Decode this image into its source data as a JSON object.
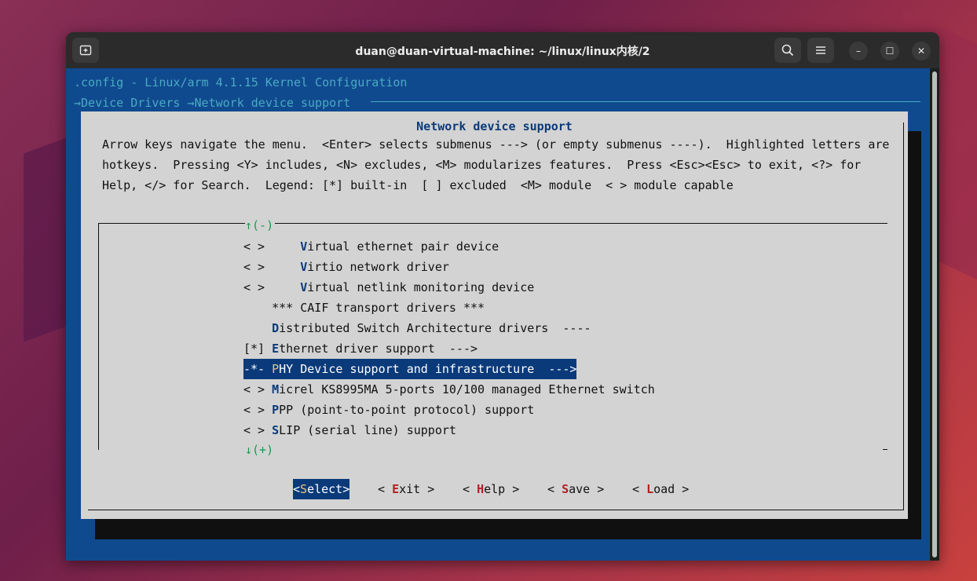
{
  "window": {
    "title": "duan@duan-virtual-machine: ~/linux/linux内核/2",
    "new_tab_icon": "new-tab-icon",
    "search_icon": "search-icon",
    "menu_icon": "hamburger-menu-icon",
    "minimize": "–",
    "maximize": "☐",
    "close": "✕"
  },
  "terminal": {
    "header": ".config - Linux/arm 4.1.15 Kernel Configuration",
    "breadcrumb": "→Device Drivers →Network device support"
  },
  "dialog": {
    "title": "Network device support",
    "help_lines": [
      "Arrow keys navigate the menu.  <Enter> selects submenus ---> (or empty submenus ----).  Highlighted letters are",
      "hotkeys.  Pressing <Y> includes, <N> excludes, <M> modularizes features.  Press <Esc><Esc> to exit, <?> for",
      "Help, </> for Search.  Legend: [*] built-in  [ ] excluded  <M> module  < > module capable"
    ],
    "scroll_up": "↑(-)",
    "scroll_down": "↓(+)",
    "items": [
      {
        "prefix": "< >     ",
        "hotkey": "V",
        "rest": "irtual ethernet pair device"
      },
      {
        "prefix": "< >     ",
        "hotkey": "V",
        "rest": "irtio network driver"
      },
      {
        "prefix": "< >     ",
        "hotkey": "V",
        "rest": "irtual netlink monitoring device"
      },
      {
        "prefix": "    ",
        "hotkey": "",
        "rest": "*** CAIF transport drivers ***"
      },
      {
        "prefix": "    ",
        "hotkey": "D",
        "rest": "istributed Switch Architecture drivers  ----"
      },
      {
        "prefix": "[*] ",
        "hotkey": "E",
        "rest": "thernet driver support  --->"
      },
      {
        "prefix": "-*- ",
        "hotkey": "P",
        "rest": "HY Device support and infrastructure  --->"
      },
      {
        "prefix": "< > ",
        "hotkey": "M",
        "rest": "icrel KS8995MA 5-ports 10/100 managed Ethernet switch"
      },
      {
        "prefix": "< > ",
        "hotkey": "P",
        "rest": "PP (point-to-point protocol) support"
      },
      {
        "prefix": "< > ",
        "hotkey": "S",
        "rest": "LIP (serial line) support"
      }
    ],
    "buttons": [
      {
        "open": "<",
        "hotkey": "S",
        "rest": "elect",
        "close": ">"
      },
      {
        "open": "< ",
        "hotkey": "E",
        "rest": "xit",
        "close": " >"
      },
      {
        "open": "< ",
        "hotkey": "H",
        "rest": "elp",
        "close": " >"
      },
      {
        "open": "< ",
        "hotkey": "S",
        "rest": "ave",
        "close": " >"
      },
      {
        "open": "< ",
        "hotkey": "L",
        "rest": "oad",
        "close": " >"
      }
    ]
  }
}
